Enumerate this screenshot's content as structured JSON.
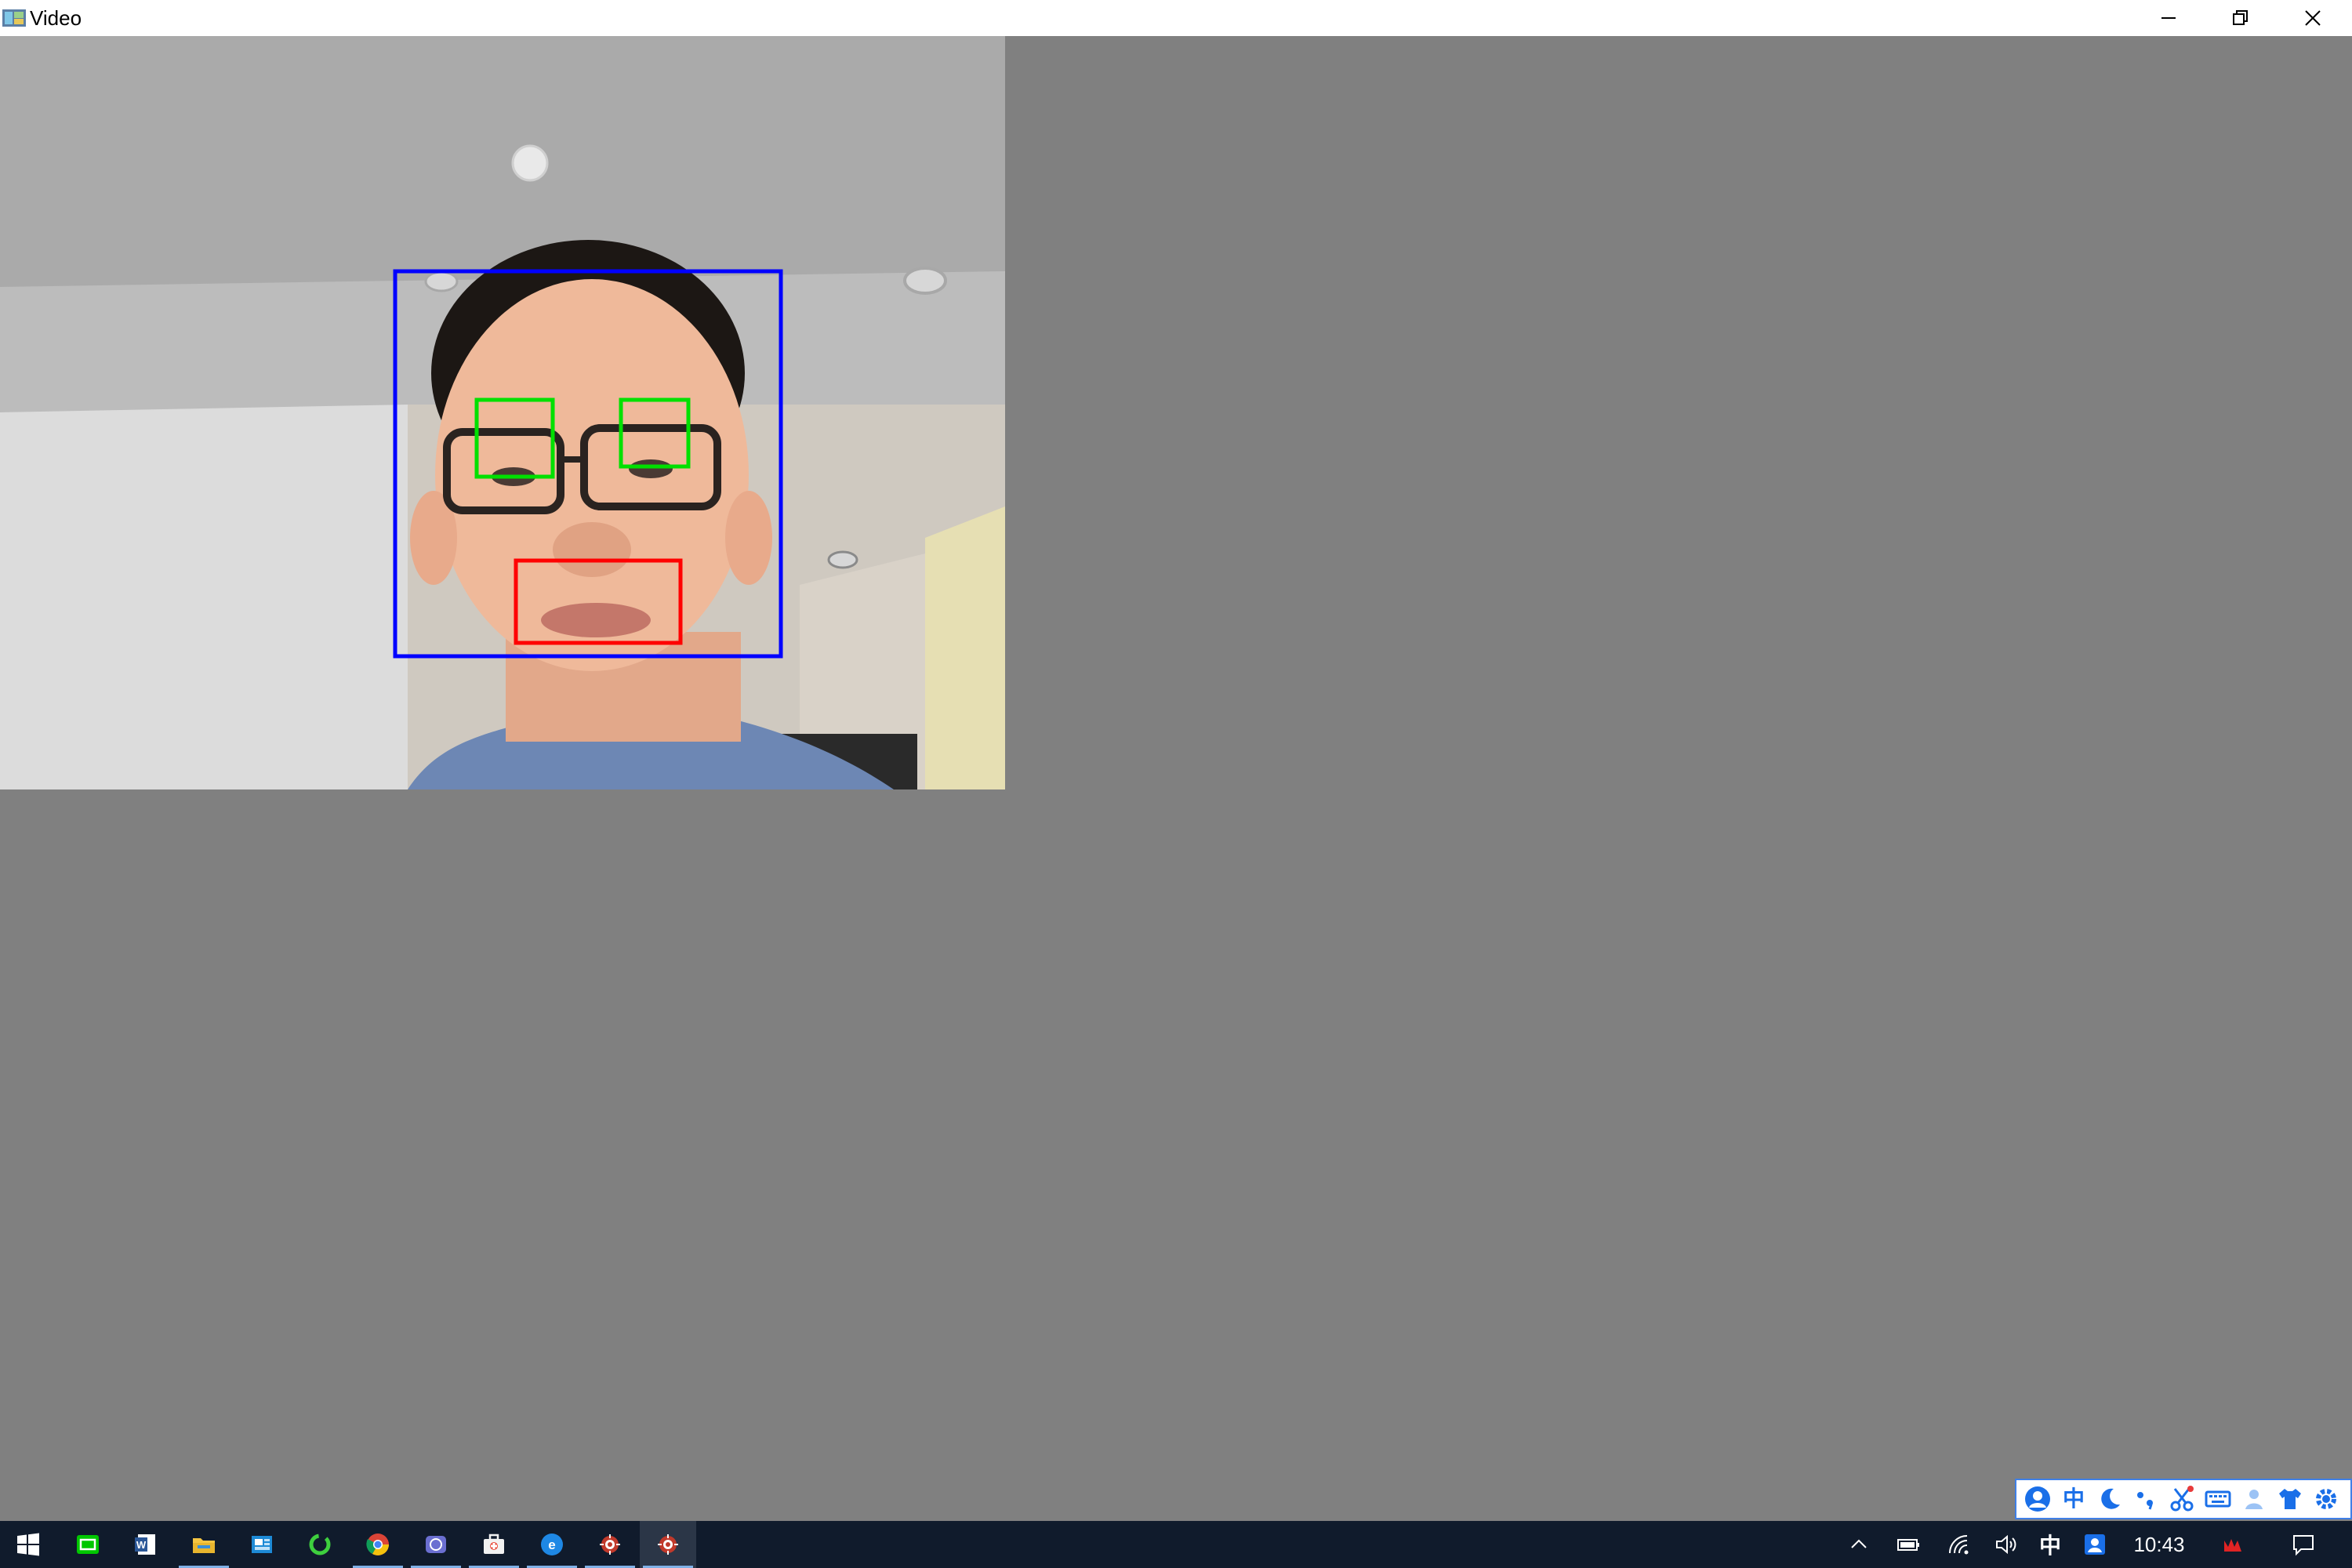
{
  "window": {
    "title": "Video",
    "controls": [
      "minimize",
      "restore",
      "close"
    ]
  },
  "video": {
    "content": "webcam frame with face detection overlays",
    "detections": [
      {
        "label": "face",
        "color": "#0000ff"
      },
      {
        "label": "eye",
        "color": "#00e000"
      },
      {
        "label": "eye",
        "color": "#00e000"
      },
      {
        "label": "mouth",
        "color": "#ff0000"
      }
    ]
  },
  "ime_toolbar": {
    "mode_char": "中",
    "icons": [
      "user-icon",
      "chinese-mode",
      "moon-icon",
      "punctuation-icon",
      "scissors-icon",
      "keyboard-icon",
      "person-icon",
      "shirt-icon",
      "settings-icon"
    ]
  },
  "taskbar": {
    "apps": [
      {
        "name": "start-button"
      },
      {
        "name": "iqiyi-app"
      },
      {
        "name": "word-app"
      },
      {
        "name": "file-explorer-app"
      },
      {
        "name": "outlook-app"
      },
      {
        "name": "qihoo-app"
      },
      {
        "name": "chrome-app"
      },
      {
        "name": "vlc-like-app"
      },
      {
        "name": "toolbox-app"
      },
      {
        "name": "ie-app"
      },
      {
        "name": "opencv-app-1"
      },
      {
        "name": "opencv-app-2"
      }
    ],
    "tray": {
      "ime_indicator": "中",
      "time": "10:43"
    }
  },
  "colors": {
    "background": "#808080",
    "taskbar": "#101b2c",
    "face_box": "#0000ff",
    "eye_box": "#00e000",
    "mouth_box": "#ff0000"
  }
}
